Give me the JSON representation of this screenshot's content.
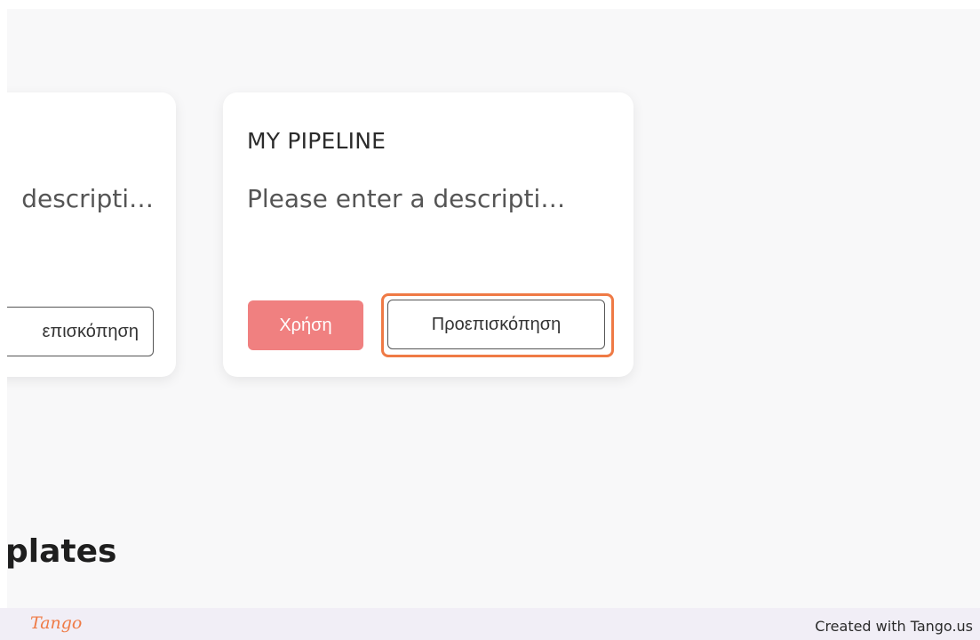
{
  "cards": {
    "left": {
      "description": "descripti…",
      "preview_label": "επισκόπηση"
    },
    "main": {
      "title": "MY PIPELINE",
      "description": "Please enter a descripti…",
      "use_label": "Χρήση",
      "preview_label": "Προεπισκόπηση"
    }
  },
  "section": {
    "heading": "plates"
  },
  "footer": {
    "logo": "Tango",
    "credit": "Created with Tango.us"
  },
  "colors": {
    "use_button": "#f08080",
    "highlight": "#ef7a45",
    "background": "#f8f8f9",
    "footer_bg": "#f1eef6"
  }
}
